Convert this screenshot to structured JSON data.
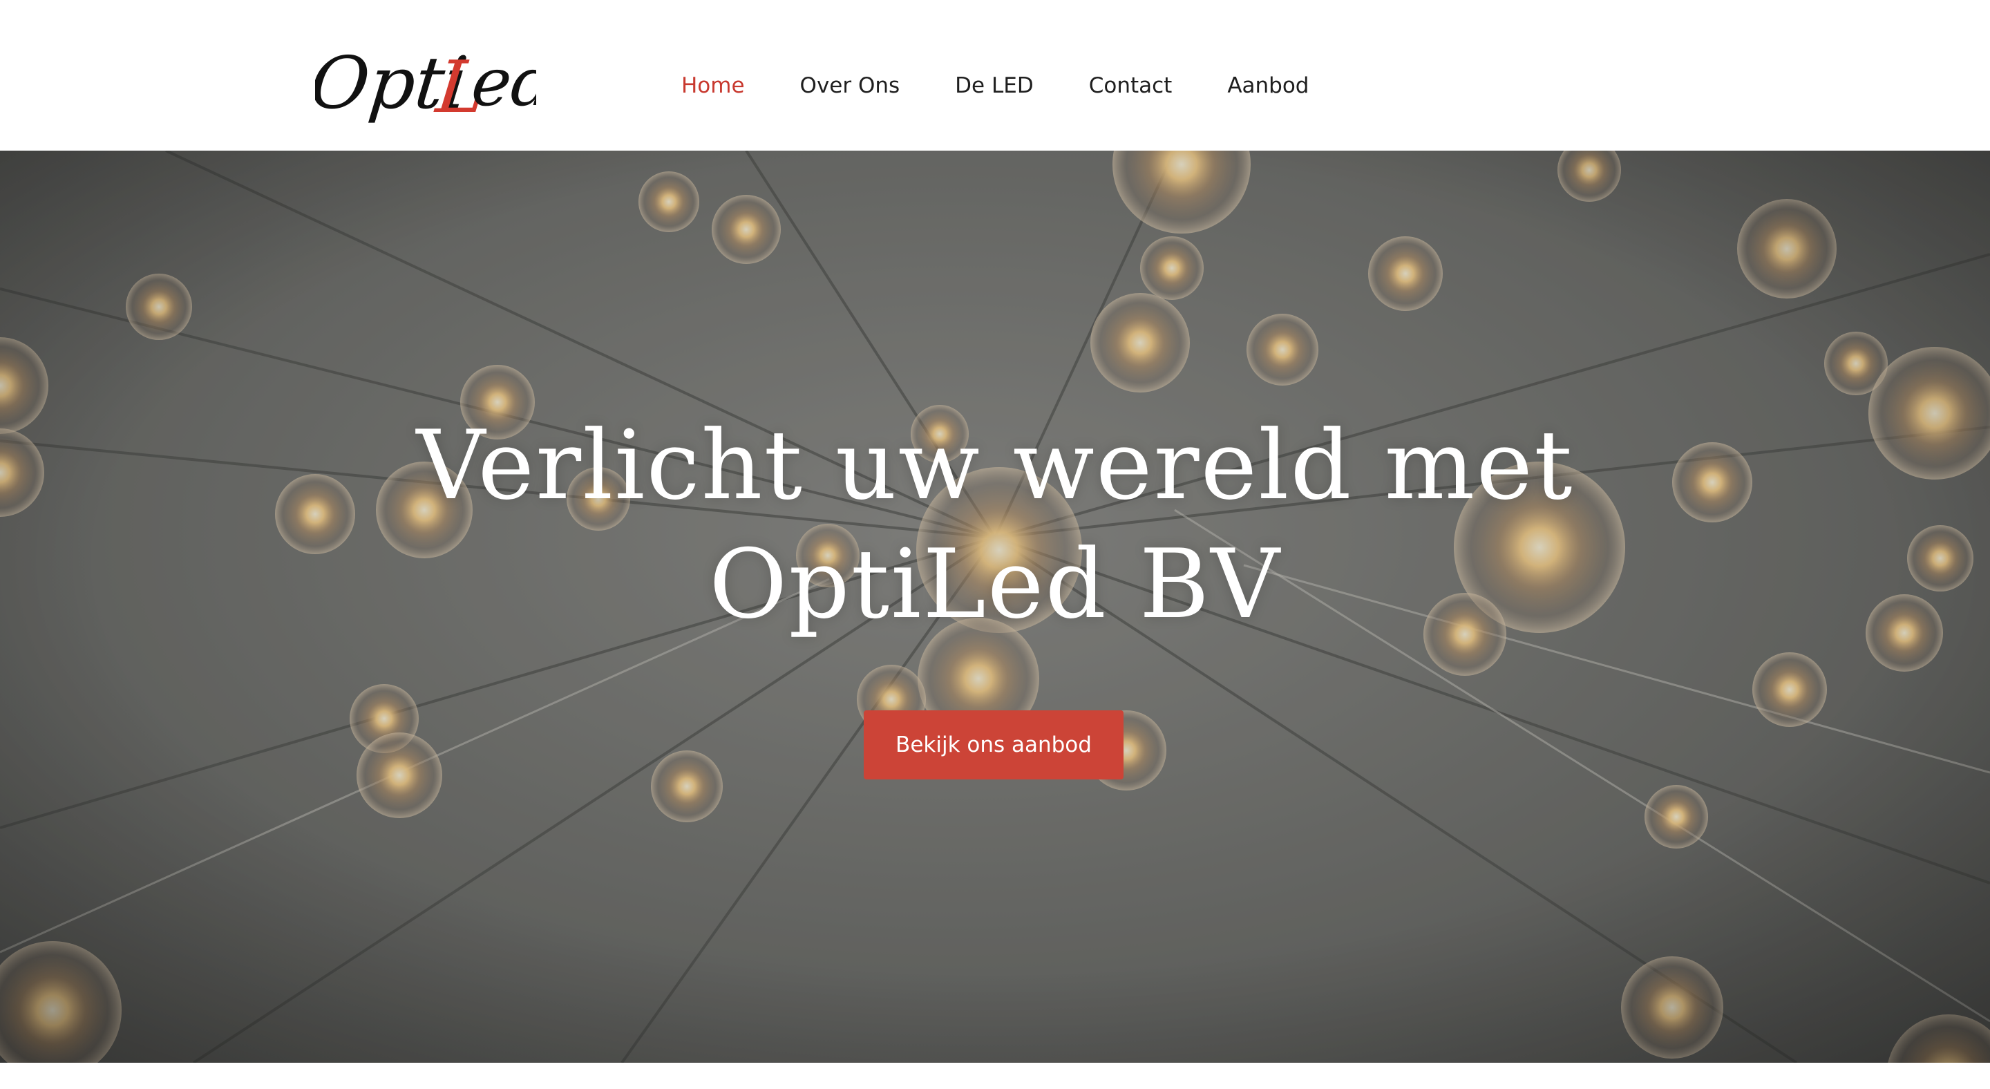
{
  "brand": {
    "logo_text_1": "Opti",
    "logo_text_2": "L",
    "logo_text_3": "ed",
    "logo_accent_color": "#d33a2f",
    "logo_color": "#111111"
  },
  "nav": {
    "items": [
      {
        "label": "Home",
        "active": true
      },
      {
        "label": "Over Ons",
        "active": false
      },
      {
        "label": "De LED",
        "active": false
      },
      {
        "label": "Contact",
        "active": false
      },
      {
        "label": "Aanbod",
        "active": false
      }
    ],
    "active_color": "#c8392f"
  },
  "hero": {
    "title_line1": "Verlicht uw wereld met",
    "title_line2": "OptiLed BV",
    "cta_label": "Bekijk ons aanbod",
    "cta_color": "#cc4437",
    "background": "hanging-light-bulbs-photo"
  }
}
